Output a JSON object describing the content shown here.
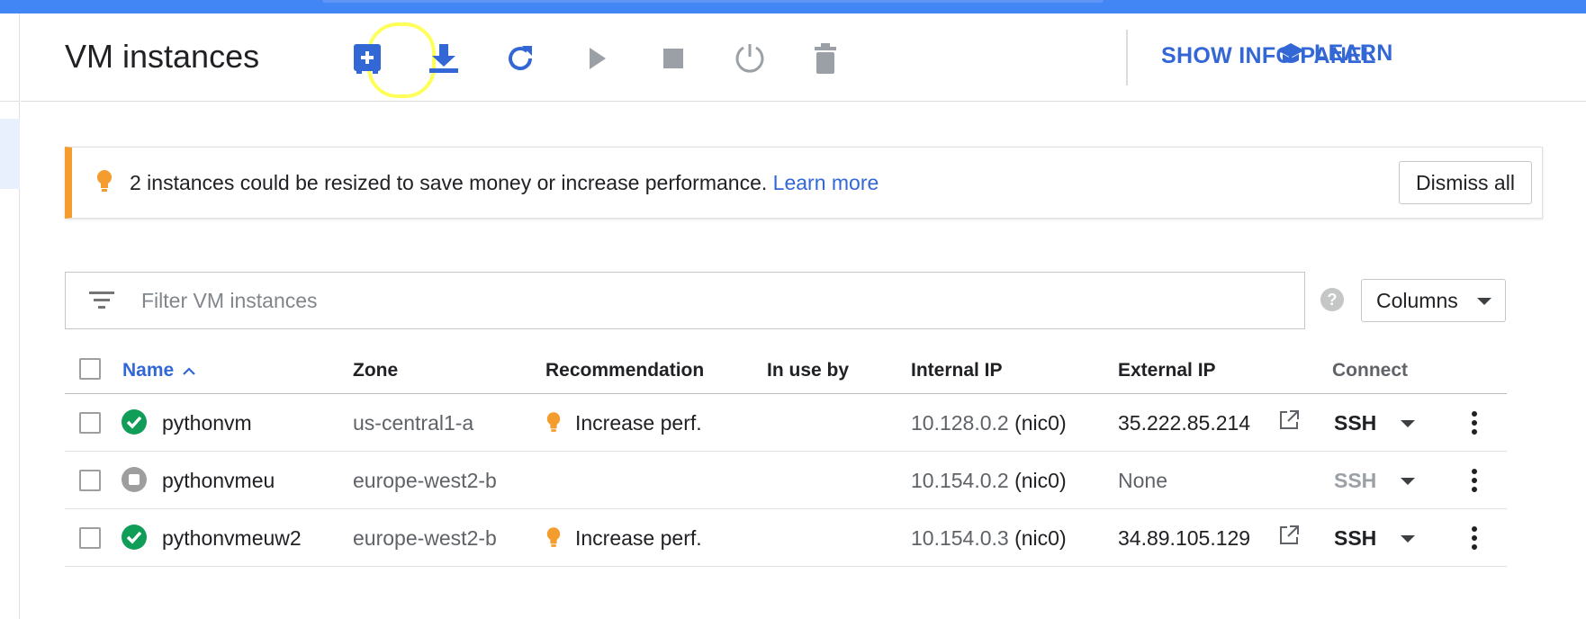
{
  "colors": {
    "brand_blue": "#4285f4",
    "link_blue": "#3367d6",
    "running_green": "#0f9d58",
    "stopped_grey": "#9e9e9e",
    "warning_orange": "#f49c2d",
    "highlight_yellow": "#ffff5a"
  },
  "header": {
    "title": "VM instances",
    "toolbar": [
      {
        "name": "create-instance-icon",
        "enabled": true
      },
      {
        "name": "import-vm-icon",
        "enabled": true
      },
      {
        "name": "refresh-icon",
        "enabled": true
      },
      {
        "name": "start-icon",
        "enabled": false
      },
      {
        "name": "stop-icon",
        "enabled": false
      },
      {
        "name": "reset-icon",
        "enabled": false
      },
      {
        "name": "delete-icon",
        "enabled": false
      }
    ],
    "show_info_panel": "SHOW INFO PANEL",
    "learn": "LEARN"
  },
  "banner": {
    "icon": "lightbulb-icon",
    "message": "2 instances could be resized to save money or increase performance.",
    "link": "Learn more",
    "dismiss": "Dismiss all"
  },
  "filter": {
    "icon": "filter-list-icon",
    "placeholder": "Filter VM instances",
    "value": ""
  },
  "columns_button": "Columns",
  "table": {
    "headers": {
      "name": "Name",
      "zone": "Zone",
      "recommendation": "Recommendation",
      "in_use_by": "In use by",
      "internal_ip": "Internal IP",
      "external_ip": "External IP",
      "connect": "Connect"
    },
    "sort": {
      "column": "name",
      "direction": "ascending"
    },
    "rows": [
      {
        "status": "running",
        "name": "pythonvm",
        "zone": "us-central1-a",
        "recommendation": "Increase perf.",
        "in_use_by": "",
        "internal_ip": "10.128.0.2",
        "internal_nic": "(nic0)",
        "external_ip": "35.222.85.214",
        "has_external_link": true,
        "connect": "SSH",
        "connect_enabled": true
      },
      {
        "status": "stopped",
        "name": "pythonvmeu",
        "zone": "europe-west2-b",
        "recommendation": "",
        "in_use_by": "",
        "internal_ip": "10.154.0.2",
        "internal_nic": "(nic0)",
        "external_ip": "None",
        "has_external_link": false,
        "connect": "SSH",
        "connect_enabled": false
      },
      {
        "status": "running",
        "name": "pythonvmeuw2",
        "zone": "europe-west2-b",
        "recommendation": "Increase perf.",
        "in_use_by": "",
        "internal_ip": "10.154.0.3",
        "internal_nic": "(nic0)",
        "external_ip": "34.89.105.129",
        "has_external_link": true,
        "connect": "SSH",
        "connect_enabled": true
      }
    ]
  }
}
